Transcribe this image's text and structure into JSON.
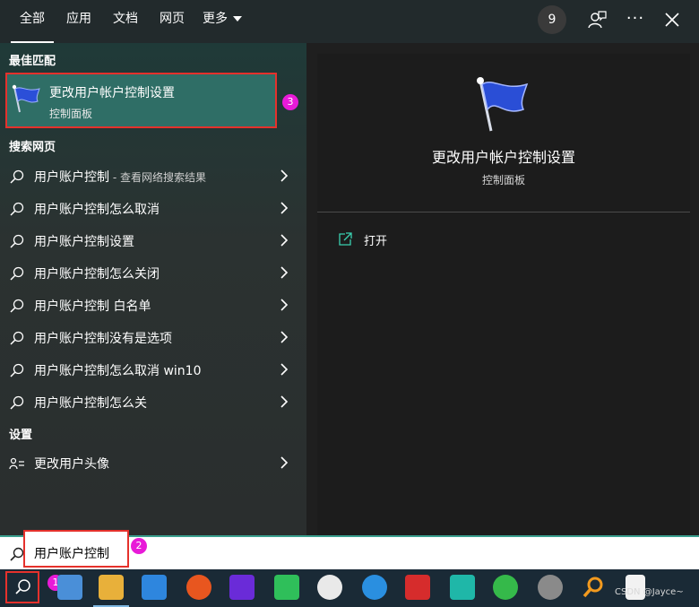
{
  "tabs": {
    "all": "全部",
    "apps": "应用",
    "docs": "文档",
    "web": "网页",
    "more": "更多"
  },
  "badge_count": "9",
  "left": {
    "best_match_header": "最佳匹配",
    "best_match": {
      "title": "更改用户帐户控制设置",
      "subtitle": "控制面板"
    },
    "search_web_header": "搜索网页",
    "web_results": [
      {
        "label": "用户账户控制",
        "suffix": " - 查看网络搜索结果"
      },
      {
        "label": "用户账户控制怎么取消",
        "suffix": ""
      },
      {
        "label": "用户账户控制设置",
        "suffix": ""
      },
      {
        "label": "用户账户控制怎么关闭",
        "suffix": ""
      },
      {
        "label": "用户账户控制 白名单",
        "suffix": ""
      },
      {
        "label": "用户账户控制没有是选项",
        "suffix": ""
      },
      {
        "label": "用户账户控制怎么取消 win10",
        "suffix": ""
      },
      {
        "label": "用户账户控制怎么关",
        "suffix": ""
      }
    ],
    "settings_header": "设置",
    "settings_item": "更改用户头像"
  },
  "right": {
    "title": "更改用户帐户控制设置",
    "subtitle": "控制面板",
    "open_label": "打开"
  },
  "search": {
    "value": "用户账户控制"
  },
  "callouts": {
    "one": "1",
    "two": "2",
    "three": "3"
  },
  "watermark": "CSDN @Jayce~",
  "colors": {
    "accent_teal": "#2f6e66",
    "highlight_red": "#e5312c",
    "callout_magenta": "#e81ad8"
  }
}
